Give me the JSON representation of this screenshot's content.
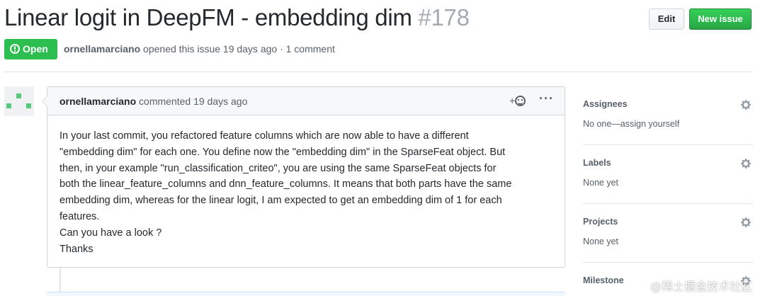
{
  "issue": {
    "title": "Linear logit in DeepFM - embedding dim",
    "number": "#178",
    "state": "Open",
    "author": "ornellamarciano",
    "opened_text": "opened this issue 19 days ago · 1 comment"
  },
  "actions": {
    "edit_label": "Edit",
    "new_issue_label": "New issue"
  },
  "comment": {
    "author": "ornellamarciano",
    "time_text": "commented 19 days ago",
    "reaction_label": "+",
    "more_label": "···",
    "body_lines": [
      "In your last commit, you refactored feature columns which are now able to have a different",
      "\"embedding dim\" for each one. You define now the \"embedding dim\" in the SparseFeat object. But",
      "then, in your example \"run_classification_criteo\", you are using the same SparseFeat objects for",
      "both the linear_feature_columns and dnn_feature_columns. It means that both parts have the same",
      "embedding dim, whereas for the linear logit, I am expected to get an embedding dim of 1 for each",
      "features.",
      "Can you have a look ?",
      "Thanks"
    ]
  },
  "sidebar": {
    "assignees": {
      "heading": "Assignees",
      "value": "No one—assign yourself"
    },
    "labels": {
      "heading": "Labels",
      "value": "None yet"
    },
    "projects": {
      "heading": "Projects",
      "value": "None yet"
    },
    "milestone": {
      "heading": "Milestone"
    }
  },
  "watermark": "@稀土掘金技术社区",
  "colors": {
    "open_green": "#2cbe4e",
    "new_issue_green": "#28a745",
    "avatar_green": "#5cc87f",
    "muted_text": "#586069"
  }
}
